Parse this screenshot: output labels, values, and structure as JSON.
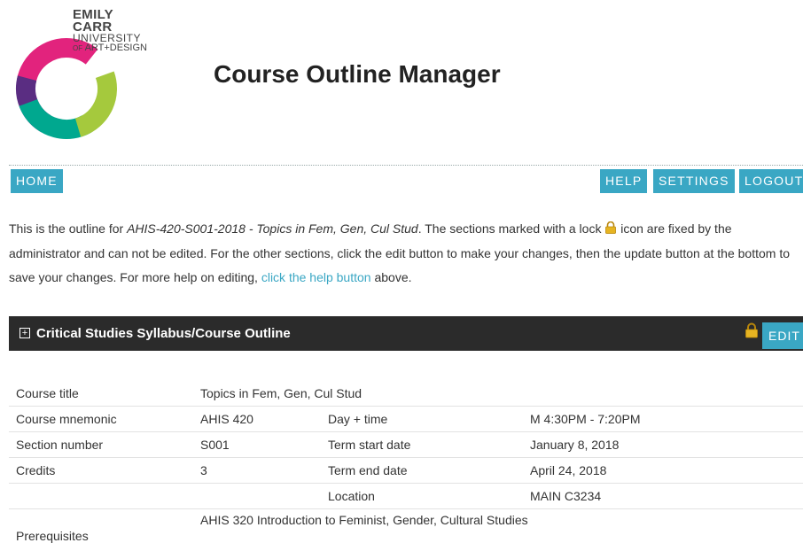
{
  "logo": {
    "line1": "EMILY",
    "line2": "CARR",
    "line3": "UNIVERSITY",
    "line4_prefix": "OF",
    "line4": "ART+DESIGN"
  },
  "header": {
    "title": "Course Outline Manager"
  },
  "nav": {
    "home": "HOME",
    "help": "HELP",
    "settings": "SETTINGS",
    "logout": "LOGOUT"
  },
  "intro": {
    "part1": "This is the outline for ",
    "course_id": "AHIS-420-S001-2018 - Topics in Fem, Gen, Cul Stud",
    "part2": ". The sections marked with a lock ",
    "part3": " icon are fixed by the administrator and can not be edited. For the other sections, click the edit button to make your changes, then the update button at the bottom to save your changes. For more help on editing, ",
    "help_link": "click the help button",
    "part4": " above."
  },
  "section": {
    "expand_glyph": "+",
    "title": "Critical Studies Syllabus/Course Outline",
    "edit_label": "EDIT"
  },
  "outline": {
    "course_title_label": "Course title",
    "course_title": "Topics in Fem, Gen, Cul Stud",
    "mnemonic_label": "Course mnemonic",
    "mnemonic": "AHIS 420",
    "daytime_label": "Day + time",
    "daytime": "M 4:30PM - 7:20PM",
    "section_label": "Section number",
    "section": "S001",
    "term_start_label": "Term start date",
    "term_start": "January 8, 2018",
    "credits_label": "Credits",
    "credits": "3",
    "term_end_label": "Term end date",
    "term_end": "April 24, 2018",
    "location_label": "Location",
    "location": "MAIN C3234",
    "prereq_label": "Prerequisites",
    "prereq": "AHIS 320 Introduction to Feminist, Gender, Cultural Studies"
  },
  "colors": {
    "accent": "#3aa7c4",
    "section_bar": "#2b2b2b",
    "lock": "#e6b422"
  },
  "icons": {
    "lock": "lock-icon",
    "expand": "plus-square-icon"
  }
}
